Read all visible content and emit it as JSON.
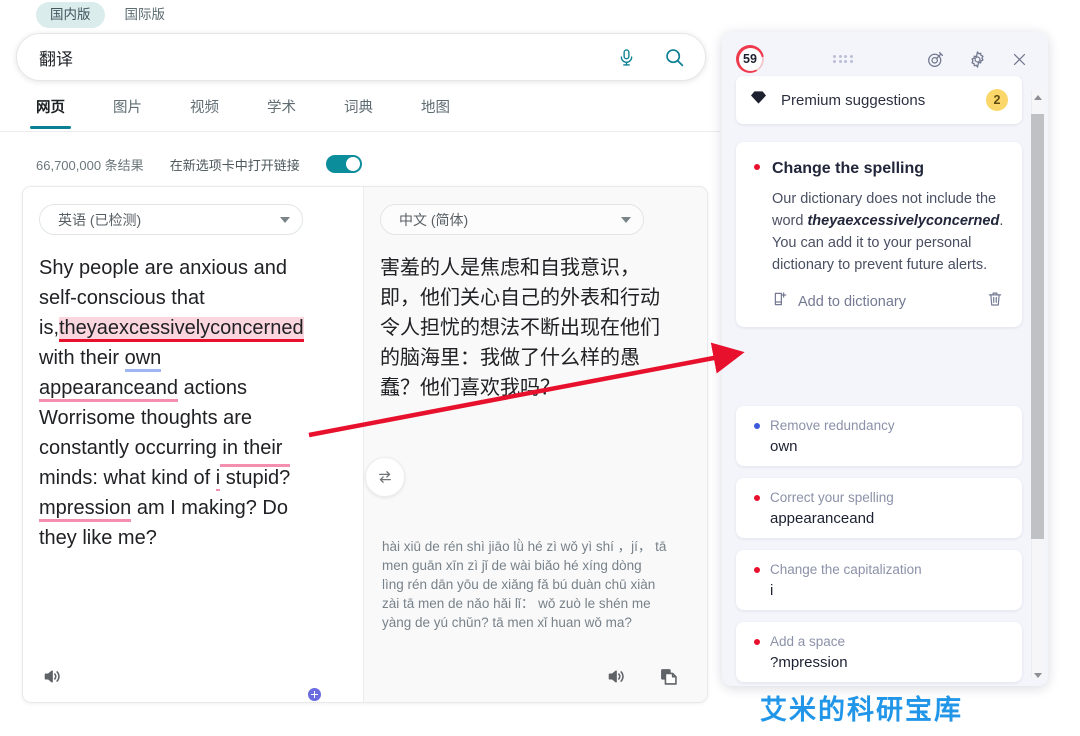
{
  "edition": {
    "tabs": [
      {
        "label": "国内版",
        "active": true
      },
      {
        "label": "国际版",
        "active": false
      }
    ]
  },
  "search": {
    "query": "翻译",
    "mic_icon": "microphone-icon",
    "search_icon": "search-icon",
    "accent": "#0b7f93"
  },
  "nav": {
    "tabs": [
      {
        "label": "网页",
        "active": true
      },
      {
        "label": "图片",
        "active": false
      },
      {
        "label": "视频",
        "active": false
      },
      {
        "label": "学术",
        "active": false
      },
      {
        "label": "词典",
        "active": false
      },
      {
        "label": "地图",
        "active": false
      }
    ]
  },
  "meta": {
    "result_count": "66,700,000 条结果",
    "toggle_label": "在新选项卡中打开链接",
    "toggle_on": true,
    "toggle_color": "#0b8d9b"
  },
  "translate": {
    "source": {
      "language": "英语 (已检测)",
      "text_segments": [
        {
          "t": "Shy people are anxious and self-conscious that is,",
          "style": "plain"
        },
        {
          "t": "theyaexcessivelyconcerned",
          "style": "hl-red"
        },
        {
          "t": " with their ",
          "style": "plain"
        },
        {
          "t": "own",
          "style": "ul-blue"
        },
        {
          "t": "\n",
          "style": "plain"
        },
        {
          "t": "appearanceand",
          "style": "ul-pink"
        },
        {
          "t": " actions Worrisome thoughts are constantly occurring in their minds: what kind of ",
          "style": "plain"
        },
        {
          "t": "i",
          "style": "ul-pink-thin"
        },
        {
          "t": " stupid?",
          "style": "plain"
        },
        {
          "t": "\n",
          "style": "plain"
        },
        {
          "t": "mpression",
          "style": "ul-pink"
        },
        {
          "t": " am I making? Do they like me?",
          "style": "plain"
        }
      ],
      "full_text": "Shy people are anxious and self-conscious that is,theyaexcessivelyconcerned with their own appearanceand actions Worrisome thoughts are constantly occurring in their minds: what kind of i stupid? mpression am I making? Do they like me?",
      "speaker_icon": "speaker-icon",
      "plus_badge": "grammarly-add-icon"
    },
    "target": {
      "language": "中文 (简体)",
      "text": "害羞的人是焦虑和自我意识，即，他们关心自己的外表和行动\n令人担忧的想法不断出现在他们的脑海里：我做了什么样的愚蠢？他们喜欢我吗？",
      "pinyin": "hài xiū de rén shì jiāo lǜ hé zì wǒ yì shí ，jí， tā men guān xīn zì jǐ de wài biǎo hé xíng dòng\nlìng rén dān yōu de xiǎng fǎ bú duàn chū xiàn zài tā men de nǎo hǎi lǐ： wǒ zuò le shén me yàng de yú chǔn? tā men xǐ huan wǒ ma?",
      "speaker_icon": "speaker-icon",
      "copy_icon": "copy-icon"
    },
    "swap_icon": "swap-languages-icon"
  },
  "grammarly": {
    "score": "59",
    "score_ring_color": "#ef3a4e",
    "drag_handle": "drag-handle-icon",
    "goal_icon": "goals-target-icon",
    "settings_icon": "gear-icon",
    "close_icon": "close-icon",
    "premium": {
      "label": "Premium suggestions",
      "icon": "diamond-icon",
      "count": "2",
      "badge_color": "#fbd76a"
    },
    "main_card": {
      "title": "Change the spelling",
      "dot_color": "#e8112d",
      "body_before": "Our dictionary does not include the word ",
      "body_word": "theyaexcessivelyconcerned",
      "body_after": ". You can add it to your personal dictionary to prevent future alerts.",
      "add_label": "Add to dictionary",
      "add_icon": "add-to-dictionary-icon",
      "delete_icon": "trash-icon"
    },
    "cards": [
      {
        "title": "Remove redundancy",
        "word": "own",
        "dot": "blue"
      },
      {
        "title": "Correct your spelling",
        "word": "appearanceand",
        "dot": "red"
      },
      {
        "title": "Change the capitalization",
        "word": "i",
        "dot": "red"
      },
      {
        "title": "Add a space",
        "word": "?mpression",
        "dot": "red"
      }
    ]
  },
  "annotation": {
    "arrow_color": "#e8112d"
  },
  "watermark": {
    "text": "艾米的科研宝库",
    "color": "#2196e8"
  }
}
